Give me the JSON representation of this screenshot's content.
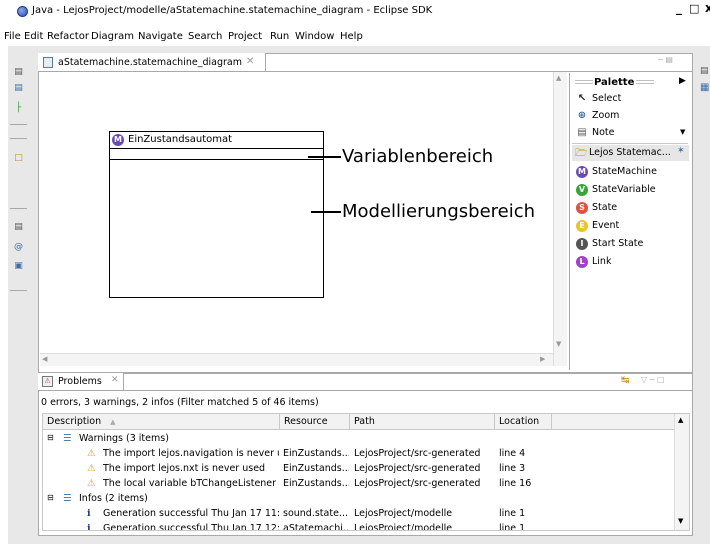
{
  "window": {
    "title": "Java - LejosProject/modelle/aStatemachine.statemachine_diagram - Eclipse SDK",
    "minimize": "_",
    "maximize": "□"
  },
  "menu": [
    "File",
    "Edit",
    "Refactor",
    "Diagram",
    "Navigate",
    "Search",
    "Project",
    "Run",
    "Window",
    "Help"
  ],
  "editor": {
    "tab_label": "aStatemachine.statemachine_diagram",
    "tab_close": "✕"
  },
  "diagram": {
    "state_icon_letter": "M",
    "state_name": "EinZustandsautomat",
    "annotation_variables": "Variablenbereich",
    "annotation_modeling": "Modellierungsbereich"
  },
  "palette": {
    "title": "Palette",
    "tools": [
      {
        "label": "Select",
        "icon": "pointer-icon"
      },
      {
        "label": "Zoom",
        "icon": "zoom-icon"
      },
      {
        "label": "Note",
        "icon": "note-icon"
      }
    ],
    "drawer": "Lejos Statemac...",
    "elements": [
      {
        "label": "StateMachine",
        "letter": "M",
        "color": "#6a4cb0"
      },
      {
        "label": "StateVariable",
        "letter": "V",
        "color": "#35a535"
      },
      {
        "label": "State",
        "letter": "S",
        "color": "#e0503a"
      },
      {
        "label": "Event",
        "letter": "E",
        "color": "#e8c52a"
      },
      {
        "label": "Start State",
        "letter": "I",
        "color": "#555555"
      },
      {
        "label": "Link",
        "letter": "L",
        "color": "#a140c8"
      }
    ]
  },
  "problems": {
    "tab_label": "Problems",
    "summary": "0 errors, 3 warnings, 2 infos (Filter matched 5 of 46 items)",
    "columns": [
      "Description",
      "Resource",
      "Path",
      "Location"
    ],
    "groups": [
      {
        "label": "Warnings (3 items)",
        "rows": [
          {
            "description": "The import lejos.navigation is never use",
            "resource": "EinZustands...",
            "path": "LejosProject/src-generated",
            "location": "line 4"
          },
          {
            "description": "The import lejos.nxt is never used",
            "resource": "EinZustands...",
            "path": "LejosProject/src-generated",
            "location": "line 3"
          },
          {
            "description": "The local variable bTChangeListener is n",
            "resource": "EinZustands...",
            "path": "LejosProject/src-generated",
            "location": "line 16"
          }
        ]
      },
      {
        "label": "Infos (2 items)",
        "rows": [
          {
            "description": "Generation successful Thu Jan 17 11:5",
            "resource": "sound.state...",
            "path": "LejosProject/modelle",
            "location": "line 1"
          },
          {
            "description": "Generation successful Thu Jan 17 12:0",
            "resource": "aStatemachi...",
            "path": "LejosProject/modelle",
            "location": "line 1"
          }
        ]
      }
    ]
  }
}
